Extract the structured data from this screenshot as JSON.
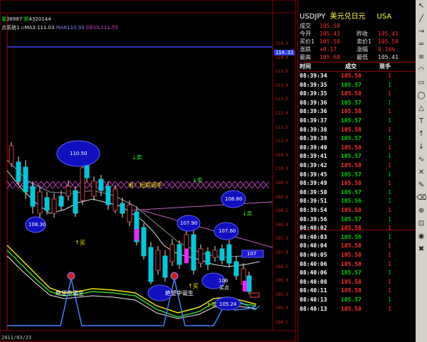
{
  "chart_header": {
    "line1_prefix": "量",
    "volume": "38987",
    "amount_prefix": "额",
    "amount": "4320144",
    "indicator_name": "点系统1",
    "ma3_label": "MA3:",
    "ma3_value": "111.03",
    "ma6_label": "MA6",
    "ma6_value": "110.93",
    "dev_label": "DEVIL",
    "dev_value": "111.55"
  },
  "price_axis": {
    "labels": [
      "114.5",
      "114.0",
      "113.5",
      "113.0",
      "112.5",
      "112.0",
      "111.5",
      "111.0",
      "110.5",
      "110.0",
      "109.5",
      "109.0",
      "108.5",
      "108.0",
      "107.5",
      "107.0",
      "106.5",
      "106.0",
      "105.5",
      "105.0",
      "104.5"
    ],
    "current_price_box": "114.31"
  },
  "annotations": {
    "bubbles": [
      "110.50",
      "108.80",
      "108.30",
      "107.90",
      "107.60",
      "107",
      "106",
      "105.24"
    ],
    "sell1": "↓卖",
    "sell2": "↓卖",
    "sell3": "↓卖",
    "buy1": "↑买",
    "buy2": "↑买",
    "buy3": "↑买",
    "buy_point": "买点",
    "trend_text": "者：抬跌调手",
    "label_despair_left": "绝望中诞生",
    "label_despair_right": "绝望中诞生",
    "bottom_left": "2011/03/23"
  },
  "quote": {
    "title": "USDJPY",
    "title_cn": "美元兑日元",
    "region": "USA",
    "rows": [
      {
        "l1": "成交",
        "v1": "105.58",
        "l2": "",
        "v2": ""
      },
      {
        "l1": "今开",
        "v1": "105.43",
        "l2": "昨收",
        "v2": "105.41"
      },
      {
        "l1": "买价1",
        "v1": "105.58",
        "l2": "卖价1",
        "v2": "105.58"
      },
      {
        "l1": "涨跌",
        "v1": "+0.17",
        "l2": "涨幅",
        "v2": "0.16%"
      },
      {
        "l1": "最高",
        "v1": "105.68",
        "l2": "最低",
        "v2": "105.41"
      }
    ],
    "ticks_header": {
      "time": "时间",
      "deal": "成交",
      "hand": "现手"
    },
    "ticks": [
      {
        "t": "08:39:34",
        "p": "105.58",
        "v": "1",
        "c": "#ff3030"
      },
      {
        "t": "08:39:35",
        "p": "105.57",
        "v": "1",
        "c": "#00d000"
      },
      {
        "t": "08:39:35",
        "p": "105.58",
        "v": "1",
        "c": "#ff3030"
      },
      {
        "t": "08:39:36",
        "p": "105.57",
        "v": "1",
        "c": "#00d000"
      },
      {
        "t": "08:39:36",
        "p": "105.58",
        "v": "1",
        "c": "#ff3030"
      },
      {
        "t": "08:39:37",
        "p": "105.57",
        "v": "1",
        "c": "#00d000"
      },
      {
        "t": "08:39:38",
        "p": "105.58",
        "v": "1",
        "c": "#ff3030"
      },
      {
        "t": "08:39:39",
        "p": "105.57",
        "v": "1",
        "c": "#00d000"
      },
      {
        "t": "08:39:40",
        "p": "105.58",
        "v": "1",
        "c": "#ff3030"
      },
      {
        "t": "08:39:41",
        "p": "105.57",
        "v": "1",
        "c": "#00d000"
      },
      {
        "t": "08:39:42",
        "p": "105.58",
        "v": "1",
        "c": "#ff3030"
      },
      {
        "t": "08:39:45",
        "p": "105.57",
        "v": "1",
        "c": "#00d000"
      },
      {
        "t": "08:39:49",
        "p": "105.58",
        "v": "1",
        "c": "#ff3030"
      },
      {
        "t": "08:39:50",
        "p": "105.57",
        "v": "1",
        "c": "#00d000"
      },
      {
        "t": "08:39:51",
        "p": "105.56",
        "v": "1",
        "c": "#00d000"
      },
      {
        "t": "08:39:54",
        "p": "105.58",
        "v": "1",
        "c": "#ff3030"
      },
      {
        "t": "08:39:56",
        "p": "105.57",
        "v": "1",
        "c": "#00d000"
      },
      {
        "t": "08:40:02",
        "p": "105.58",
        "v": "1",
        "c": "#ff3030"
      },
      {
        "t": "08:40:03",
        "p": "105.56",
        "v": "1",
        "c": "#00d000"
      },
      {
        "t": "08:40:04",
        "p": "105.58",
        "v": "1",
        "c": "#ff3030"
      },
      {
        "t": "08:40:05",
        "p": "105.58",
        "v": "1",
        "c": "#ff3030"
      },
      {
        "t": "08:40:06",
        "p": "105.58",
        "v": "1",
        "c": "#ff3030"
      },
      {
        "t": "08:40:06",
        "p": "105.57",
        "v": "1",
        "c": "#00d000"
      },
      {
        "t": "08:40:08",
        "p": "105.58",
        "v": "1",
        "c": "#ff3030"
      },
      {
        "t": "08:40:11",
        "p": "105.58",
        "v": "1",
        "c": "#ff3030"
      },
      {
        "t": "08:40:13",
        "p": "105.57",
        "v": "1",
        "c": "#00d000"
      },
      {
        "t": "08:40:13",
        "p": "105.58",
        "v": "1",
        "c": "#ff3030"
      }
    ]
  },
  "toolbar_icons": [
    "cursor-icon",
    "line-icon",
    "ray-icon",
    "channel-icon",
    "fibonacci-icon",
    "arc-icon",
    "rectangle-icon",
    "ellipse-icon",
    "triangle-icon",
    "text-icon",
    "arrow-up-icon",
    "arrow-down-icon",
    "wave-icon",
    "gann-icon",
    "pen-icon",
    "eraser-icon",
    "magnet-icon",
    "lock-icon",
    "eye-icon",
    "delete-icon"
  ]
}
